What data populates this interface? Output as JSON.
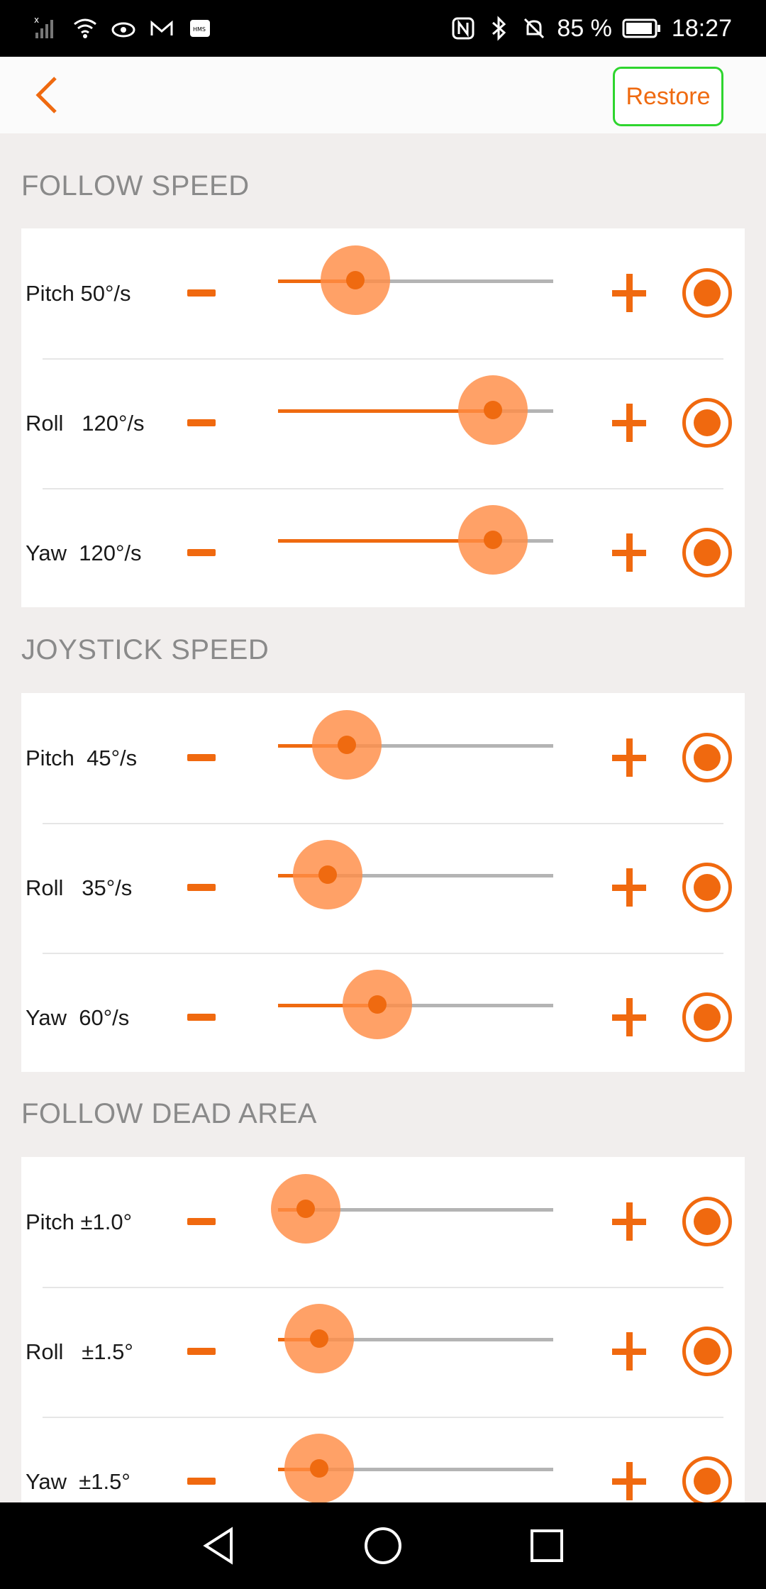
{
  "status_bar": {
    "battery_text": "85 %",
    "time": "18:27",
    "icons_left": [
      "signal-icon",
      "wifi-icon",
      "eye-icon",
      "mail-icon",
      "hms-icon"
    ],
    "icons_right": [
      "nfc-icon",
      "bluetooth-icon",
      "silent-icon",
      "battery-icon"
    ]
  },
  "header": {
    "back_icon": "chevron-left-icon",
    "restore_label": "Restore"
  },
  "colors": {
    "accent": "#ef6a10",
    "restore_border": "#2ed52e"
  },
  "sections": [
    {
      "title": "FOLLOW SPEED",
      "rows": [
        {
          "label": "Pitch 50°/s",
          "value_fraction": 0.28
        },
        {
          "label": "Roll   120°/s",
          "value_fraction": 0.78
        },
        {
          "label": "Yaw  120°/s",
          "value_fraction": 0.78
        }
      ]
    },
    {
      "title": "JOYSTICK SPEED",
      "rows": [
        {
          "label": "Pitch  45°/s",
          "value_fraction": 0.25
        },
        {
          "label": "Roll   35°/s",
          "value_fraction": 0.18
        },
        {
          "label": "Yaw  60°/s",
          "value_fraction": 0.36
        }
      ]
    },
    {
      "title": "FOLLOW DEAD AREA",
      "rows": [
        {
          "label": "Pitch ±1.0°",
          "value_fraction": 0.1
        },
        {
          "label": "Roll   ±1.5°",
          "value_fraction": 0.15
        },
        {
          "label": "Yaw  ±1.5°",
          "value_fraction": 0.15
        }
      ]
    }
  ],
  "nav_bar": {
    "icons": [
      "back-triangle-icon",
      "home-circle-icon",
      "recents-square-icon"
    ]
  }
}
